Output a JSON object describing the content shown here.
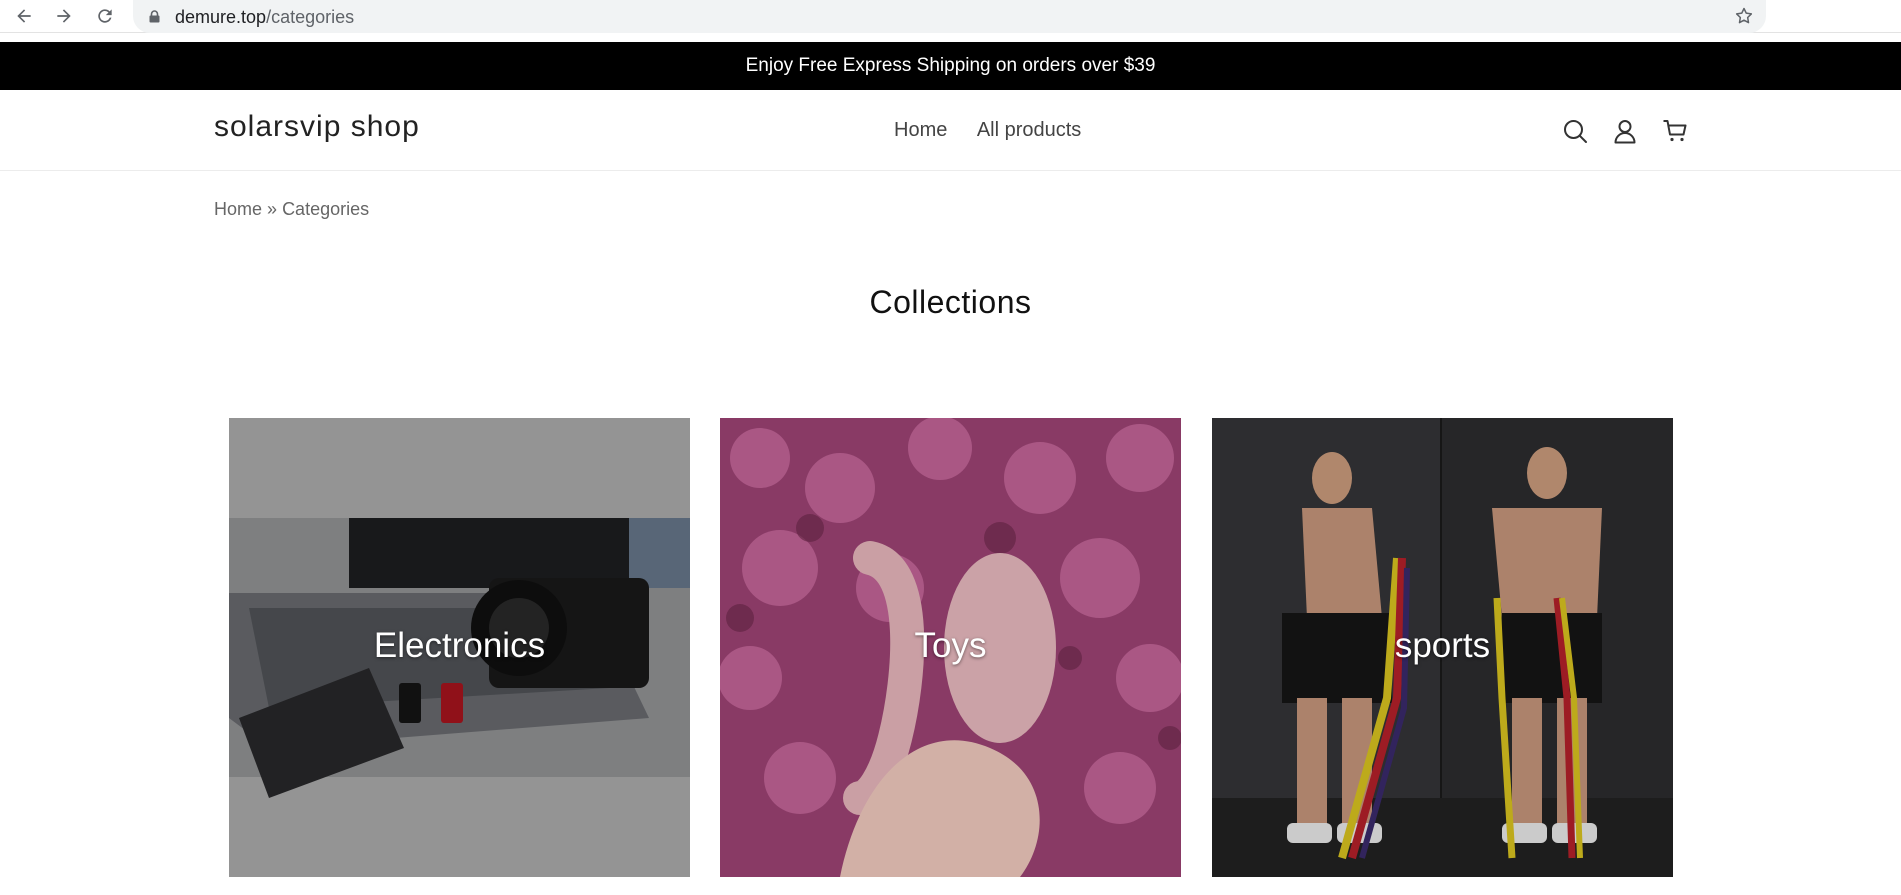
{
  "browser": {
    "url_domain": "demure.top",
    "url_path": "/categories"
  },
  "announcement": {
    "text": "Enjoy Free Express Shipping on orders over $39"
  },
  "header": {
    "logo": "solarsvip shop",
    "nav": [
      {
        "label": "Home"
      },
      {
        "label": "All products"
      }
    ],
    "icons": [
      "search-icon",
      "account-icon",
      "cart-icon"
    ]
  },
  "breadcrumb": {
    "home": "Home",
    "separator": "»",
    "current": "Categories"
  },
  "page": {
    "title": "Collections"
  },
  "collections": [
    {
      "label": "Electronics"
    },
    {
      "label": "Toys"
    },
    {
      "label": "sports"
    }
  ]
}
